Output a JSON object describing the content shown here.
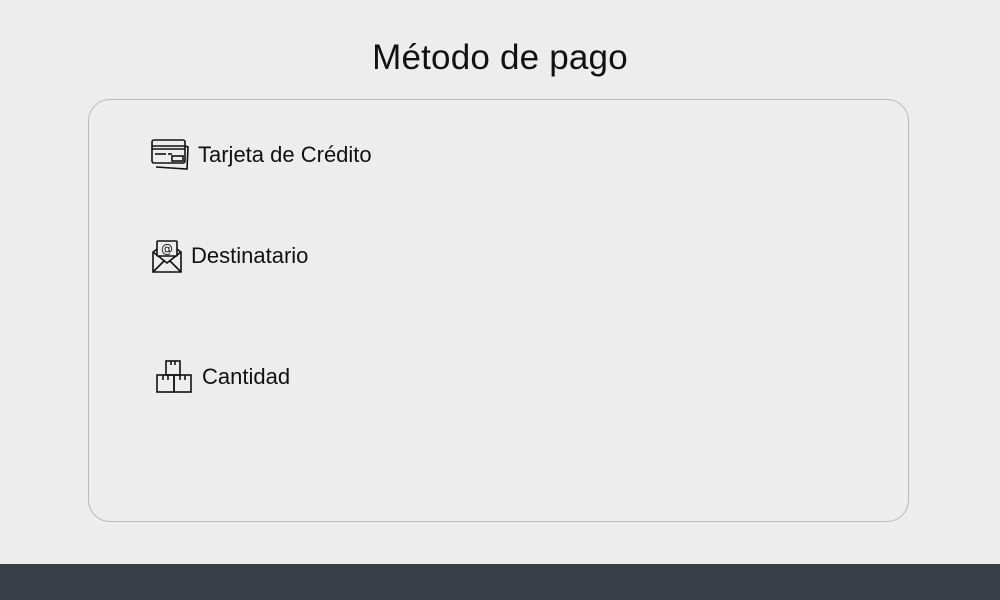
{
  "page": {
    "title": "Método de pago"
  },
  "payment_options": [
    {
      "label": "Tarjeta de Crédito",
      "icon": "credit-card-icon"
    },
    {
      "label": "Destinatario",
      "icon": "email-envelope-icon"
    },
    {
      "label": "Cantidad",
      "icon": "boxes-icon"
    }
  ],
  "colors": {
    "background": "#ededed",
    "card_border": "#b9b9b9",
    "footer": "#393d46",
    "text": "#111111"
  }
}
